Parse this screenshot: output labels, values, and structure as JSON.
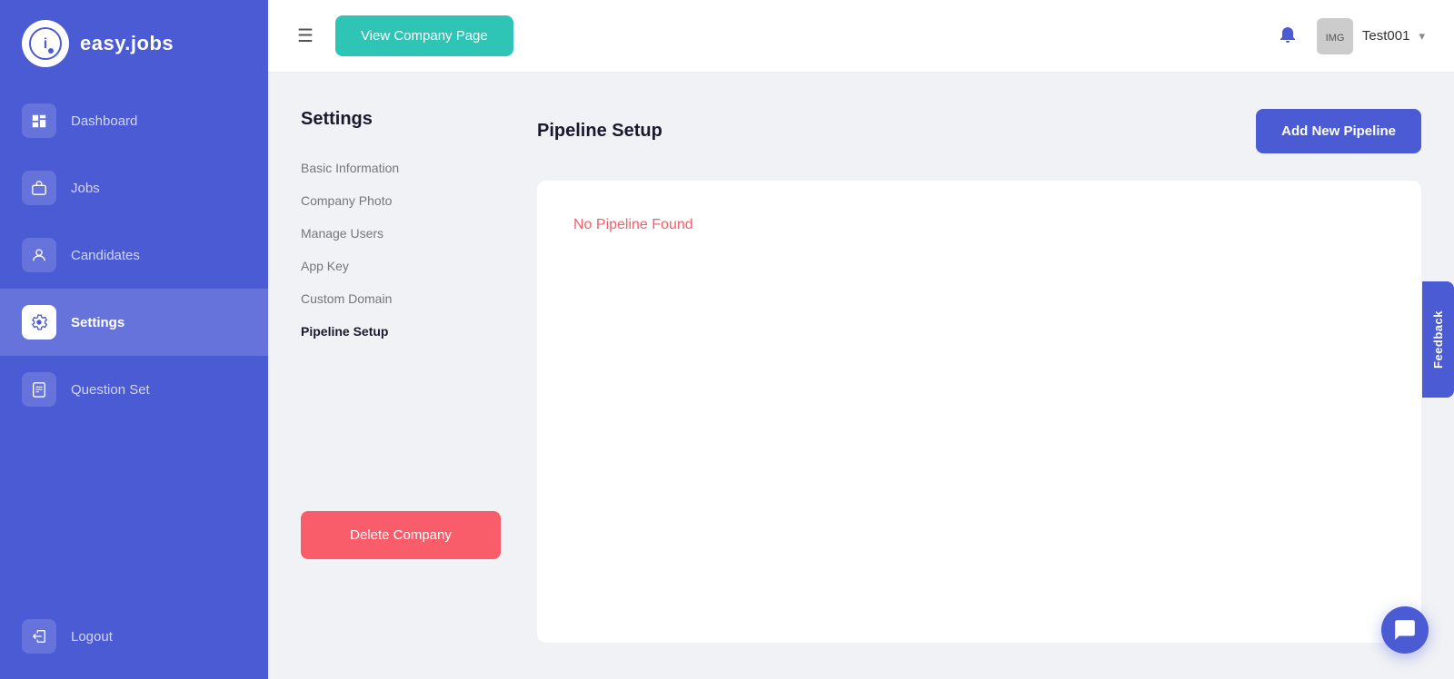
{
  "app": {
    "logo_text": "easy.jobs",
    "logo_icon": "i"
  },
  "sidebar": {
    "items": [
      {
        "id": "dashboard",
        "label": "Dashboard",
        "icon": "⌂",
        "active": false
      },
      {
        "id": "jobs",
        "label": "Jobs",
        "icon": "💼",
        "active": false
      },
      {
        "id": "candidates",
        "label": "Candidates",
        "icon": "👤",
        "active": false
      },
      {
        "id": "settings",
        "label": "Settings",
        "icon": "⚙",
        "active": true
      },
      {
        "id": "question-set",
        "label": "Question Set",
        "icon": "📄",
        "active": false
      }
    ],
    "logout_label": "Logout",
    "logout_icon": "→"
  },
  "header": {
    "view_company_label": "View Company Page",
    "menu_icon": "☰",
    "bell_icon": "🔔",
    "user_name": "Test001",
    "user_avatar_text": ""
  },
  "settings_nav": {
    "title": "Settings",
    "items": [
      {
        "id": "basic-info",
        "label": "Basic Information",
        "active": false
      },
      {
        "id": "company-photo",
        "label": "Company Photo",
        "active": false
      },
      {
        "id": "manage-users",
        "label": "Manage Users",
        "active": false
      },
      {
        "id": "app-key",
        "label": "App Key",
        "active": false
      },
      {
        "id": "custom-domain",
        "label": "Custom Domain",
        "active": false
      },
      {
        "id": "pipeline-setup",
        "label": "Pipeline Setup",
        "active": true
      }
    ],
    "delete_label": "Delete Company"
  },
  "pipeline": {
    "title": "Pipeline Setup",
    "add_button_label": "Add New Pipeline",
    "no_pipeline_text": "No Pipeline Found"
  },
  "feedback": {
    "label": "Feedback"
  },
  "chat": {
    "icon": "💬"
  }
}
